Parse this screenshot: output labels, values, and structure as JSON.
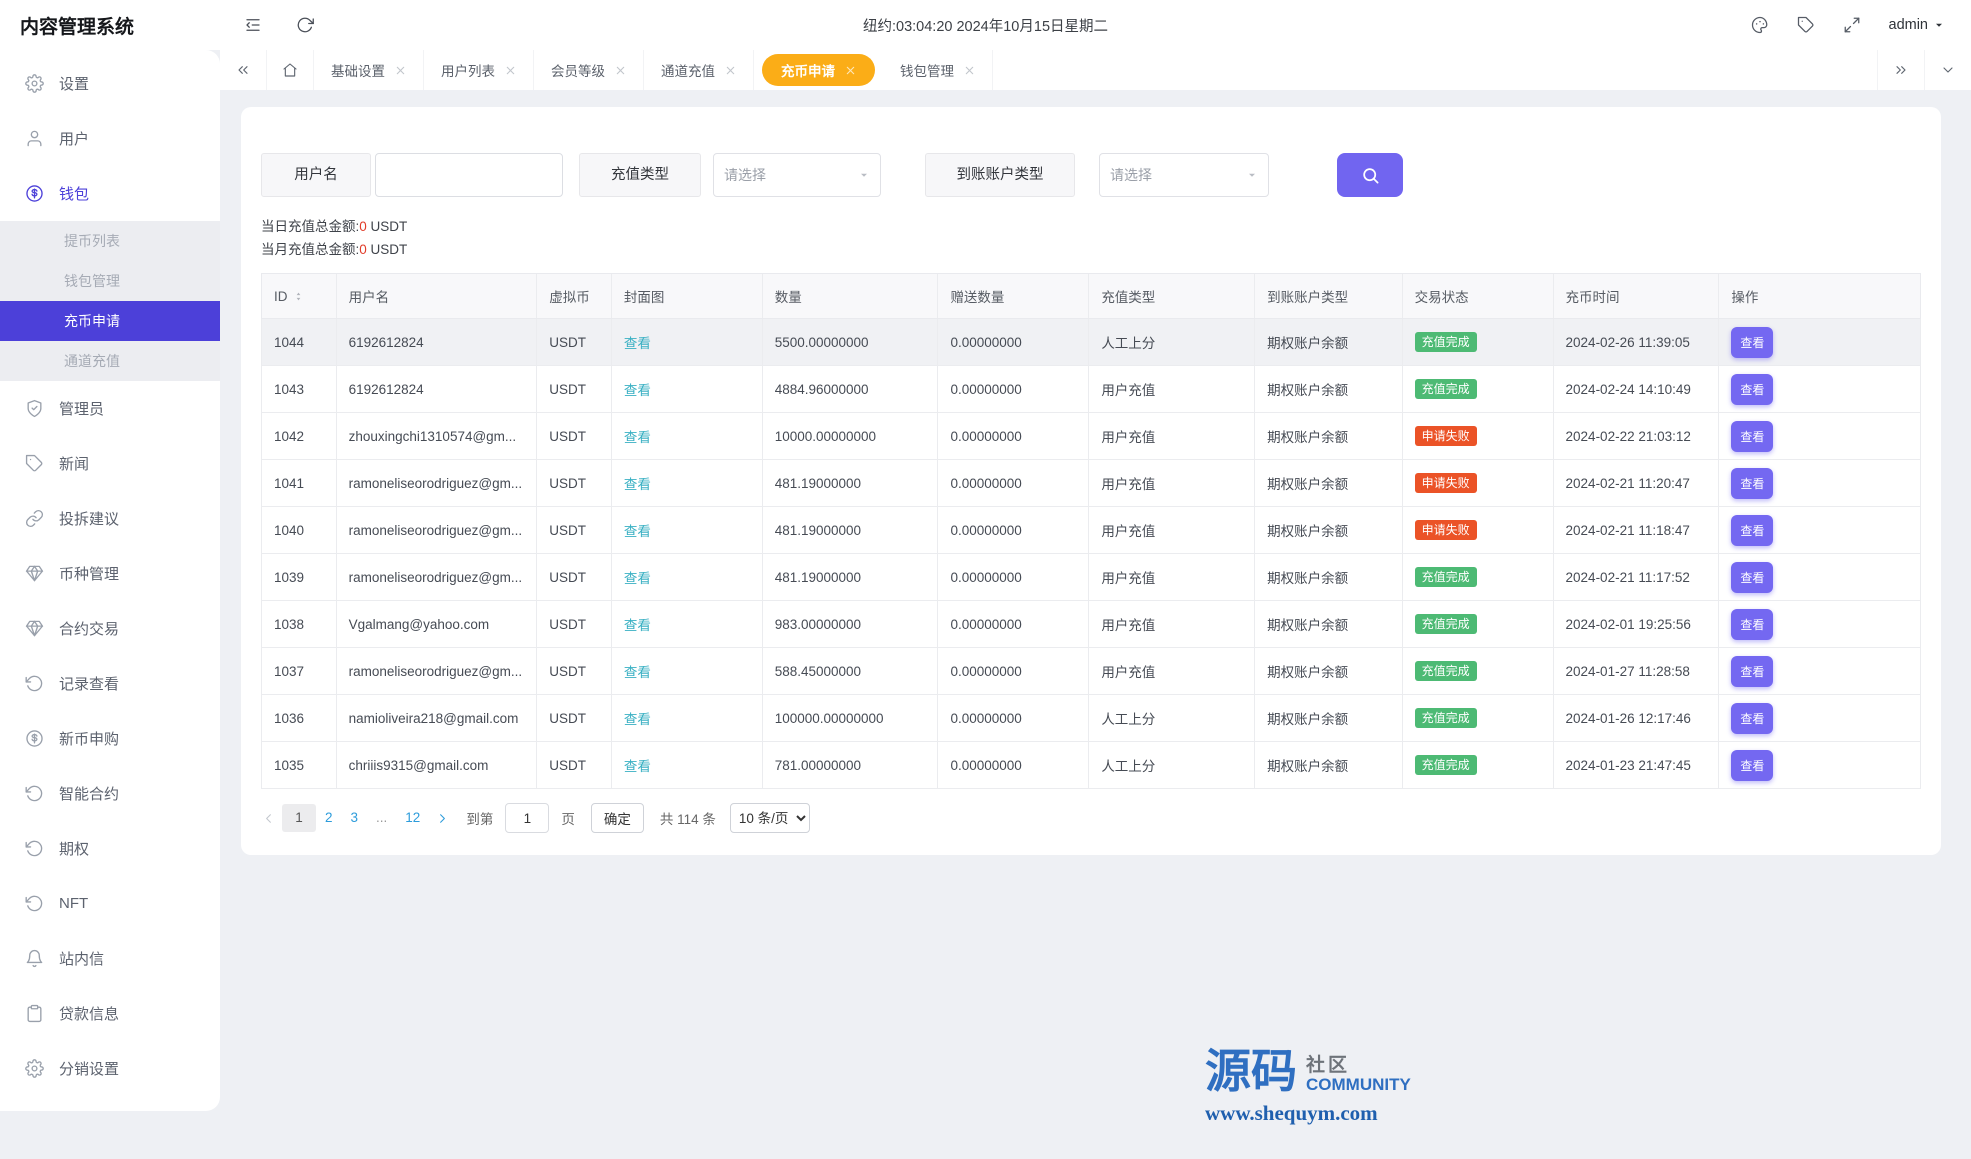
{
  "app": {
    "title": "内容管理系统"
  },
  "topbar": {
    "clock": "纽约:03:04:20 2024年10月15日星期二",
    "user": "admin",
    "icons": [
      "menu-fold",
      "refresh",
      "palette",
      "tag",
      "fullscreen"
    ]
  },
  "colors": {
    "accent_purple": "#4c40d9",
    "button_purple": "#7165f0",
    "tab_active_gold": "#fbad17",
    "status_success": "#4dba74",
    "status_fail": "#eb5327",
    "link_teal": "#39b0c3",
    "pagination_blue": "#2d9cdb"
  },
  "sidebar": {
    "items": [
      {
        "type": "top",
        "icon": "gear",
        "label": "设置"
      },
      {
        "type": "top",
        "icon": "user",
        "label": "用户"
      },
      {
        "type": "top",
        "icon": "coin",
        "label": "钱包",
        "active": true
      },
      {
        "type": "sub",
        "label": "提币列表"
      },
      {
        "type": "sub",
        "label": "钱包管理"
      },
      {
        "type": "sub",
        "label": "充币申请",
        "active": true
      },
      {
        "type": "sub",
        "label": "通道充值"
      },
      {
        "type": "top",
        "icon": "shield",
        "label": "管理员"
      },
      {
        "type": "top",
        "icon": "tag",
        "label": "新闻"
      },
      {
        "type": "top",
        "icon": "link",
        "label": "投拆建议"
      },
      {
        "type": "top",
        "icon": "gem",
        "label": "币种管理"
      },
      {
        "type": "top",
        "icon": "gem",
        "label": "合约交易"
      },
      {
        "type": "top",
        "icon": "history",
        "label": "记录查看"
      },
      {
        "type": "top",
        "icon": "coin",
        "label": "新币申购"
      },
      {
        "type": "top",
        "icon": "history",
        "label": "智能合约"
      },
      {
        "type": "top",
        "icon": "history",
        "label": "期权"
      },
      {
        "type": "top",
        "icon": "history",
        "label": "NFT"
      },
      {
        "type": "top",
        "icon": "bell",
        "label": "站内信"
      },
      {
        "type": "top",
        "icon": "clipboard",
        "label": "贷款信息"
      },
      {
        "type": "top",
        "icon": "gear",
        "label": "分销设置"
      }
    ]
  },
  "tabs": {
    "items": [
      {
        "label": "基础设置"
      },
      {
        "label": "用户列表"
      },
      {
        "label": "会员等级"
      },
      {
        "label": "通道充值"
      },
      {
        "label": "充币申请",
        "active": true
      },
      {
        "label": "钱包管理"
      }
    ]
  },
  "filters": {
    "username_label": "用户名",
    "recharge_type_label": "充值类型",
    "account_type_label": "到账账户类型",
    "select_placeholder": "请选择"
  },
  "summary": {
    "daily_label": "当日充值总金额:",
    "daily_value": "0",
    "monthly_label": "当月充值总金额:",
    "monthly_value": "0",
    "unit": "USDT"
  },
  "table": {
    "columns": [
      "ID",
      "用户名",
      "虚拟币",
      "封面图",
      "数量",
      "赠送数量",
      "充值类型",
      "到账账户类型",
      "交易状态",
      "充币时间",
      "操作"
    ],
    "rows": [
      {
        "active": true,
        "id": "1044",
        "username": "6192612824",
        "coin": "USDT",
        "cover": "查看",
        "amount": "5500.00000000",
        "bonus": "0.00000000",
        "recharge_type": "人工上分",
        "account_type": "期权账户余额",
        "status": "充值完成",
        "status_type": "success",
        "time": "2024-02-26 11:39:05",
        "action": "查看"
      },
      {
        "id": "1043",
        "username": "6192612824",
        "coin": "USDT",
        "cover": "查看",
        "amount": "4884.96000000",
        "bonus": "0.00000000",
        "recharge_type": "用户充值",
        "account_type": "期权账户余额",
        "status": "充值完成",
        "status_type": "success",
        "time": "2024-02-24 14:10:49",
        "action": "查看"
      },
      {
        "id": "1042",
        "username": "zhouxingchi1310574@gm...",
        "coin": "USDT",
        "cover": "查看",
        "amount": "10000.00000000",
        "bonus": "0.00000000",
        "recharge_type": "用户充值",
        "account_type": "期权账户余额",
        "status": "申请失败",
        "status_type": "fail",
        "time": "2024-02-22 21:03:12",
        "action": "查看"
      },
      {
        "id": "1041",
        "username": "ramoneliseorodriguez@gm...",
        "coin": "USDT",
        "cover": "查看",
        "amount": "481.19000000",
        "bonus": "0.00000000",
        "recharge_type": "用户充值",
        "account_type": "期权账户余额",
        "status": "申请失败",
        "status_type": "fail",
        "time": "2024-02-21 11:20:47",
        "action": "查看"
      },
      {
        "id": "1040",
        "username": "ramoneliseorodriguez@gm...",
        "coin": "USDT",
        "cover": "查看",
        "amount": "481.19000000",
        "bonus": "0.00000000",
        "recharge_type": "用户充值",
        "account_type": "期权账户余额",
        "status": "申请失败",
        "status_type": "fail",
        "time": "2024-02-21 11:18:47",
        "action": "查看"
      },
      {
        "id": "1039",
        "username": "ramoneliseorodriguez@gm...",
        "coin": "USDT",
        "cover": "查看",
        "amount": "481.19000000",
        "bonus": "0.00000000",
        "recharge_type": "用户充值",
        "account_type": "期权账户余额",
        "status": "充值完成",
        "status_type": "success",
        "time": "2024-02-21 11:17:52",
        "action": "查看"
      },
      {
        "id": "1038",
        "username": "Vgalmang@yahoo.com",
        "coin": "USDT",
        "cover": "查看",
        "amount": "983.00000000",
        "bonus": "0.00000000",
        "recharge_type": "用户充值",
        "account_type": "期权账户余额",
        "status": "充值完成",
        "status_type": "success",
        "time": "2024-02-01 19:25:56",
        "action": "查看"
      },
      {
        "id": "1037",
        "username": "ramoneliseorodriguez@gm...",
        "coin": "USDT",
        "cover": "查看",
        "amount": "588.45000000",
        "bonus": "0.00000000",
        "recharge_type": "用户充值",
        "account_type": "期权账户余额",
        "status": "充值完成",
        "status_type": "success",
        "time": "2024-01-27 11:28:58",
        "action": "查看"
      },
      {
        "id": "1036",
        "username": "namioliveira218@gmail.com",
        "coin": "USDT",
        "cover": "查看",
        "amount": "100000.00000000",
        "bonus": "0.00000000",
        "recharge_type": "人工上分",
        "account_type": "期权账户余额",
        "status": "充值完成",
        "status_type": "success",
        "time": "2024-01-26 12:17:46",
        "action": "查看"
      },
      {
        "id": "1035",
        "username": "chriiis9315@gmail.com",
        "coin": "USDT",
        "cover": "查看",
        "amount": "781.00000000",
        "bonus": "0.00000000",
        "recharge_type": "人工上分",
        "account_type": "期权账户余额",
        "status": "充值完成",
        "status_type": "success",
        "time": "2024-01-23 21:47:45",
        "action": "查看"
      }
    ]
  },
  "pagination": {
    "pages": [
      {
        "label": "1",
        "type": "current"
      },
      {
        "label": "2",
        "type": "num"
      },
      {
        "label": "3",
        "type": "num"
      },
      {
        "label": "...",
        "type": "dots"
      },
      {
        "label": "12",
        "type": "num"
      }
    ],
    "jump_label": "到第",
    "jump_value": "1",
    "page_suffix": "页",
    "confirm_label": "确定",
    "total_label": "共 114 条",
    "page_size": "10 条/页"
  },
  "footer": {
    "brand_cn": "源码",
    "brand_sub": "社区",
    "brand_en": "COMMUNITY",
    "url": "www.shequym.com"
  }
}
